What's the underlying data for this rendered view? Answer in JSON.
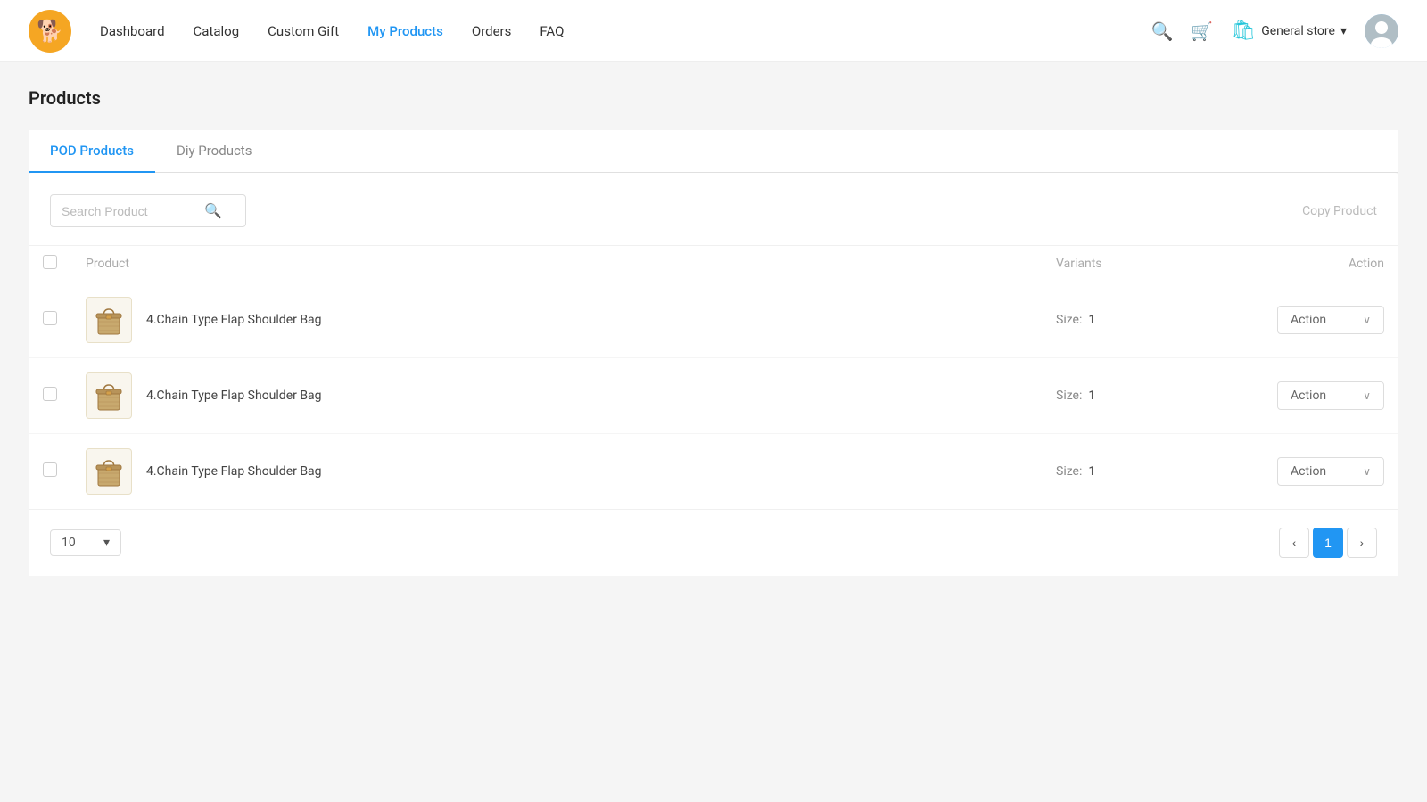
{
  "header": {
    "logo_emoji": "🐕",
    "nav_items": [
      {
        "label": "Dashboard",
        "active": false
      },
      {
        "label": "Catalog",
        "active": false
      },
      {
        "label": "Custom Gift",
        "active": false
      },
      {
        "label": "My Products",
        "active": true
      },
      {
        "label": "Orders",
        "active": false
      },
      {
        "label": "FAQ",
        "active": false
      }
    ],
    "store_label": "General store",
    "store_chevron": "▾",
    "avatar_emoji": "👤"
  },
  "page": {
    "title": "Products"
  },
  "tabs": [
    {
      "label": "POD Products",
      "active": true
    },
    {
      "label": "Diy Products",
      "active": false
    }
  ],
  "toolbar": {
    "search_placeholder": "Search Product",
    "copy_product_label": "Copy Product"
  },
  "table": {
    "headers": {
      "product": "Product",
      "variants": "Variants",
      "action": "Action"
    },
    "rows": [
      {
        "name": "4.Chain Type Flap Shoulder Bag",
        "variants_label": "Size:",
        "variants_value": "1",
        "action_label": "Action"
      },
      {
        "name": "4.Chain Type Flap Shoulder Bag",
        "variants_label": "Size:",
        "variants_value": "1",
        "action_label": "Action"
      },
      {
        "name": "4.Chain Type Flap Shoulder Bag",
        "variants_label": "Size:",
        "variants_value": "1",
        "action_label": "Action"
      }
    ]
  },
  "pagination": {
    "page_size": "10",
    "current_page": 1,
    "prev_label": "‹",
    "next_label": "›"
  }
}
